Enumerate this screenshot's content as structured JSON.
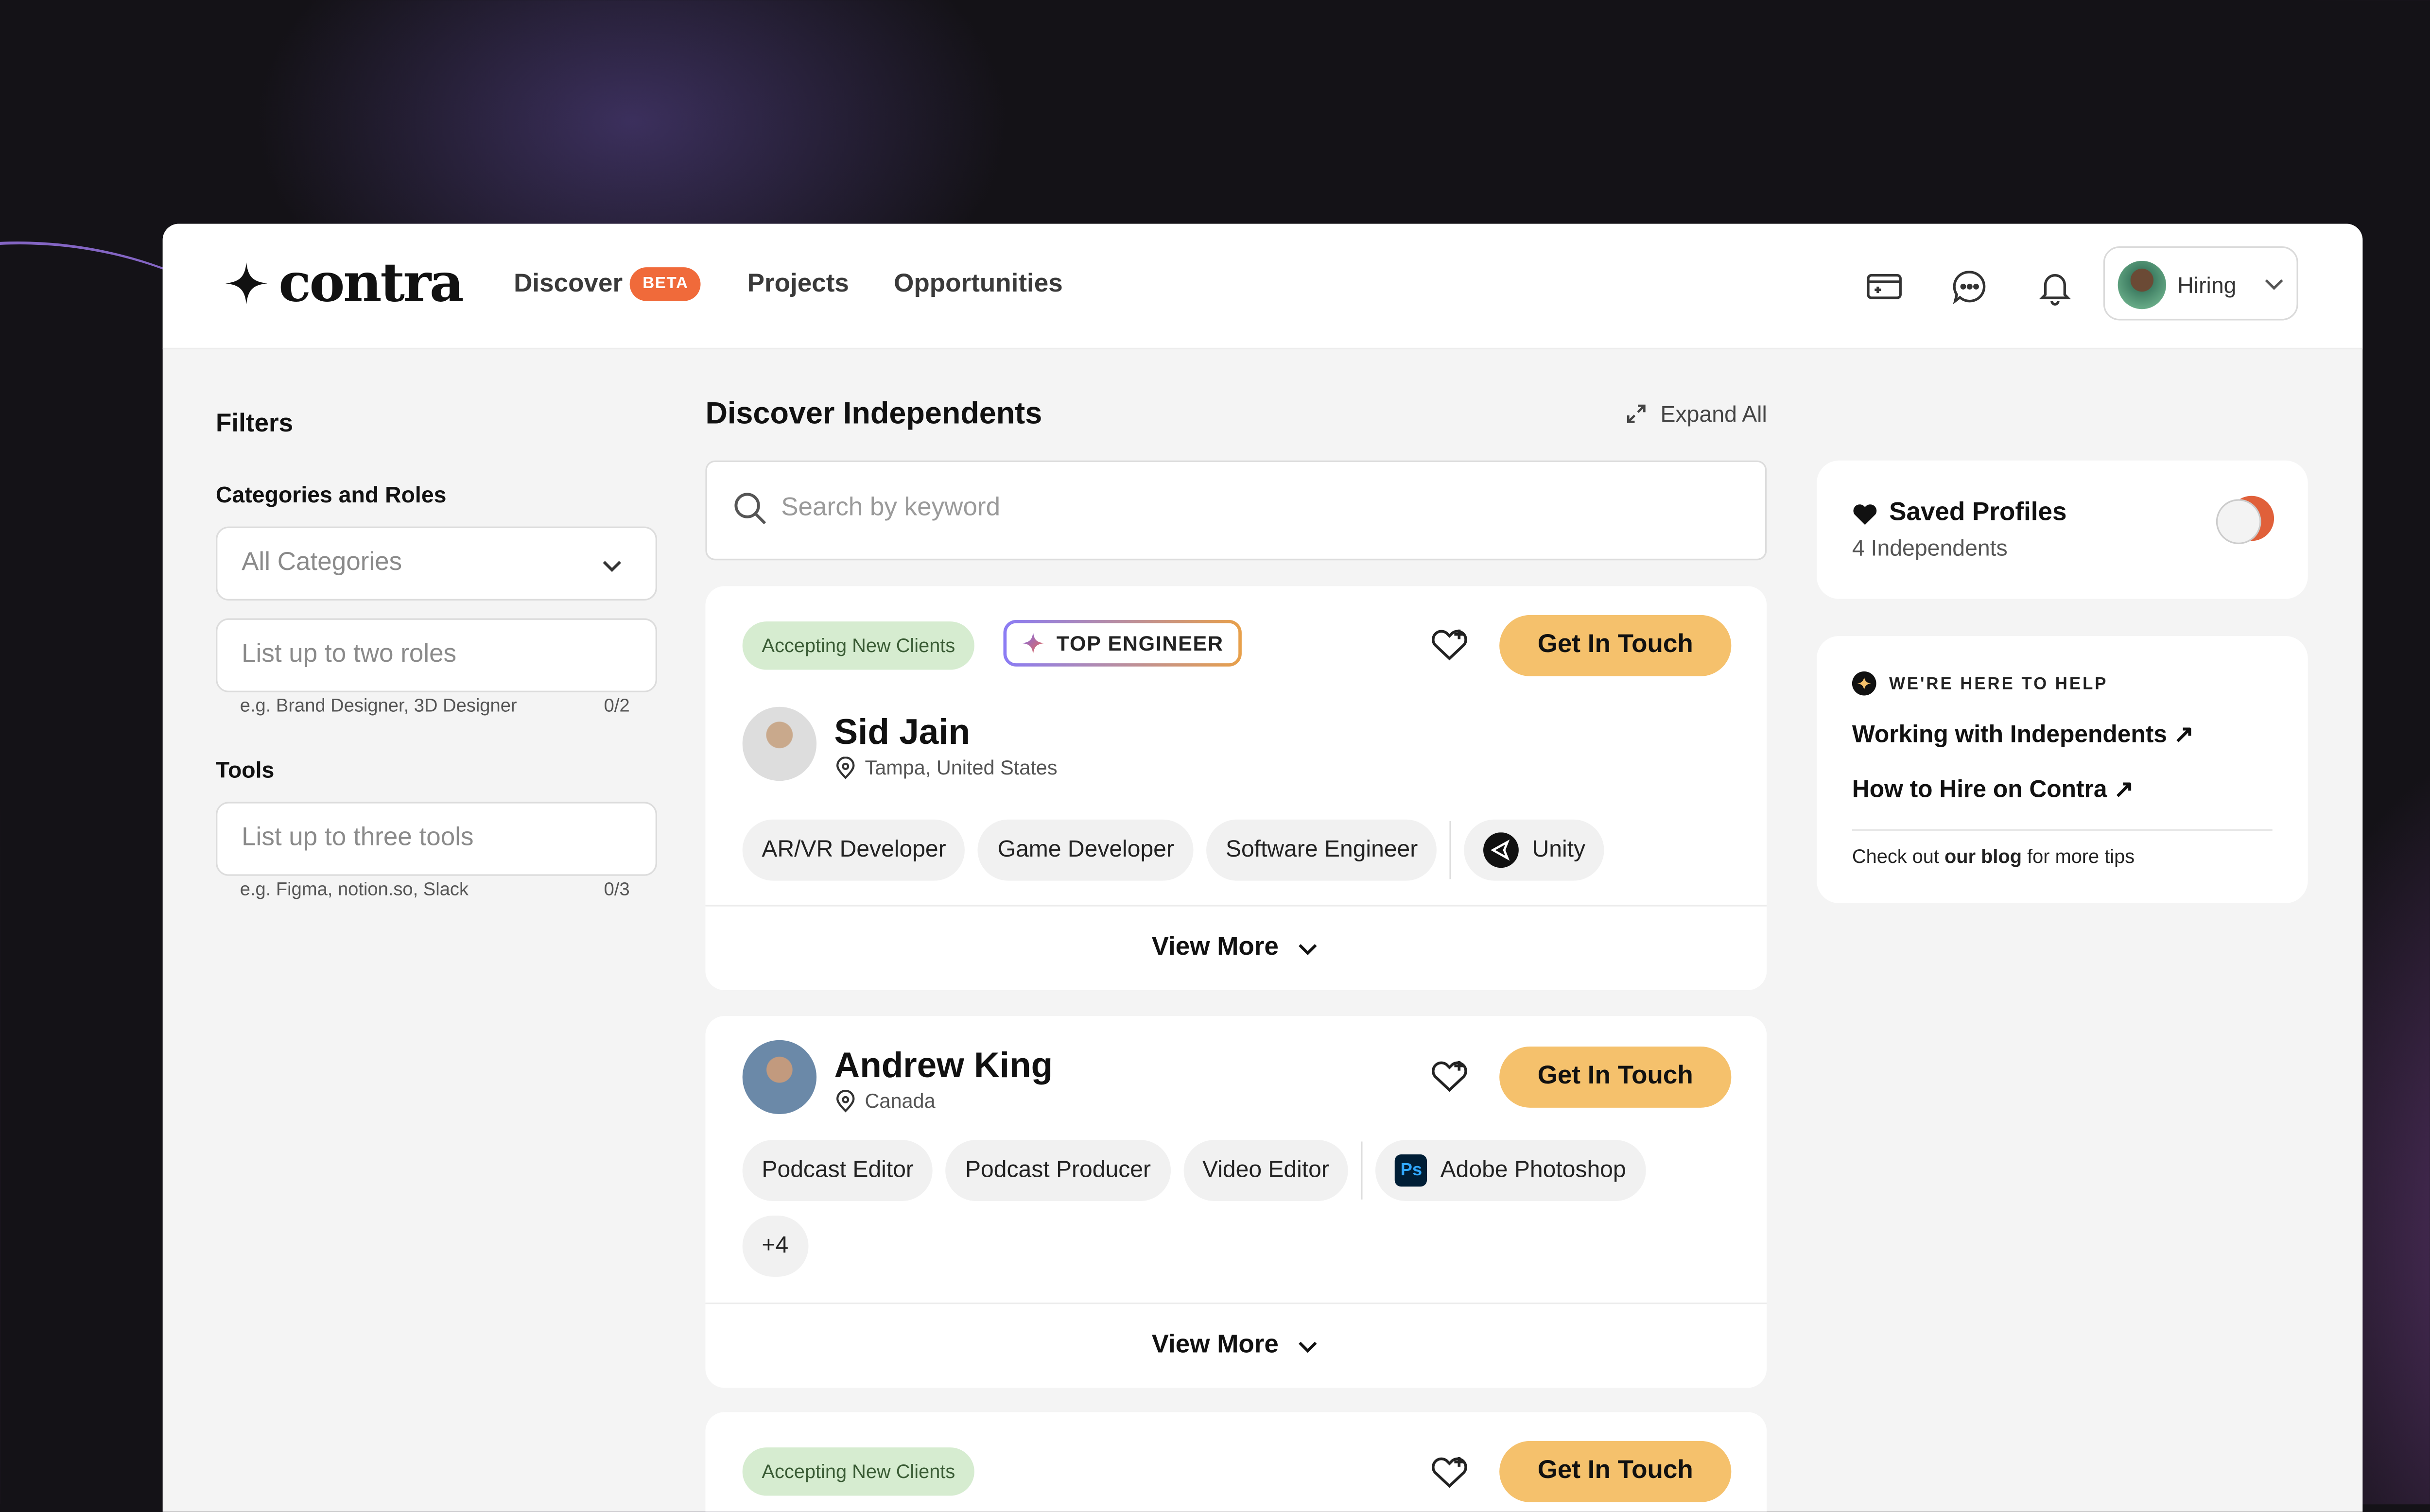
{
  "brand": {
    "name": "contra"
  },
  "nav": {
    "discover": "Discover",
    "beta": "BETA",
    "projects": "Projects",
    "opportunities": "Opportunities"
  },
  "account": {
    "label": "Hiring"
  },
  "filters": {
    "title": "Filters",
    "categories_label": "Categories and Roles",
    "categories_value": "All Categories",
    "roles_placeholder": "List up to two roles",
    "roles_hint": "e.g. Brand Designer, 3D Designer",
    "roles_count": "0/2",
    "tools_label": "Tools",
    "tools_placeholder": "List up to three tools",
    "tools_hint": "e.g. Figma, notion.so, Slack",
    "tools_count": "0/3"
  },
  "main": {
    "title": "Discover Independents",
    "expand_all": "Expand All",
    "search_placeholder": "Search by keyword",
    "get_in_touch": "Get In Touch",
    "view_more": "View More",
    "accepting": "Accepting New Clients",
    "top_engineer": "TOP ENGINEER"
  },
  "profiles": [
    {
      "name": "Sid Jain",
      "location": "Tampa, United States",
      "roles": [
        "AR/VR Developer",
        "Game Developer",
        "Software Engineer"
      ],
      "tool": "Unity"
    },
    {
      "name": "Andrew King",
      "location": "Canada",
      "roles": [
        "Podcast Editor",
        "Podcast Producer",
        "Video Editor"
      ],
      "tool": "Adobe Photoshop",
      "tool_icon": "Ps",
      "more": "+4"
    }
  ],
  "saved": {
    "title": "Saved Profiles",
    "subtitle": "4 Independents"
  },
  "help": {
    "kicker": "WE'RE HERE TO HELP",
    "link1": "Working with Independents ↗",
    "link2": "How to Hire on Contra ↗",
    "foot_pre": "Check out ",
    "foot_bold": "our blog",
    "foot_post": " for more tips"
  },
  "colors": {
    "accent": "#f5c16c",
    "beta": "#f06a3a",
    "accepting_bg": "#d6ecd0"
  }
}
